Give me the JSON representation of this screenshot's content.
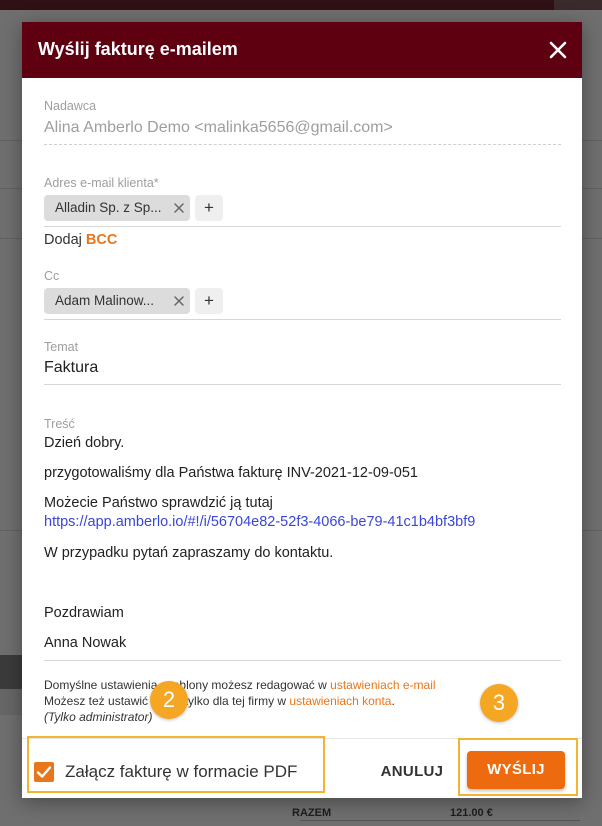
{
  "modal": {
    "title": "Wyślij fakturę e-mailem"
  },
  "sender": {
    "label": "Nadawca",
    "value": "Alina Amberlo Demo <malinka5656@gmail.com>"
  },
  "client_email": {
    "label": "Adres e-mail klienta*",
    "chip": "Alladin Sp. z Sp...",
    "add": "+"
  },
  "bcc": {
    "prefix": "Dodaj ",
    "link": "BCC"
  },
  "cc": {
    "label": "Cc",
    "chip": "Adam Malinow...",
    "add": "+"
  },
  "subject": {
    "label": "Temat",
    "value": "Faktura"
  },
  "content": {
    "label": "Treść",
    "greeting": "Dzień dobry.",
    "prepared": "przygotowaliśmy dla Państwa fakturę   INV-2021-12-09-051",
    "check": "Możecie Państwo sprawdzić ją tutaj",
    "link": "https://app.amberlo.io/#!/i/56704e82-52f3-4066-be79-41c1b4bf3bf9",
    "contact": "W przypadku pytań zapraszamy do kontaktu.",
    "regards": "Pozdrawiam",
    "signature": "Anna Nowak"
  },
  "info": {
    "line1_prefix": "Domyślne ustawienia szablony możesz redagować w ",
    "line1_link": "ustawieniach e-mail",
    "line2_prefix": "Możesz też ustawić temat tylko dla tej firmy w ",
    "line2_link": "ustawieniach konta",
    "line2_suffix": ".",
    "line3": "(Tylko administrator)"
  },
  "badges": {
    "attach": "2",
    "send": "3"
  },
  "footer": {
    "attach_label": "Załącz fakturę w formacie PDF",
    "attach_checked": true,
    "cancel_label": "ANULUJ",
    "send_label": "WYŚLIJ"
  },
  "background": {
    "total_label": "RAZEM",
    "total_value": "121.00 €"
  },
  "colors": {
    "header": "#5e0010",
    "accent": "#e8761a",
    "send_button": "#ee6a0e",
    "badge": "#f5a623",
    "link": "#3b46d6"
  }
}
